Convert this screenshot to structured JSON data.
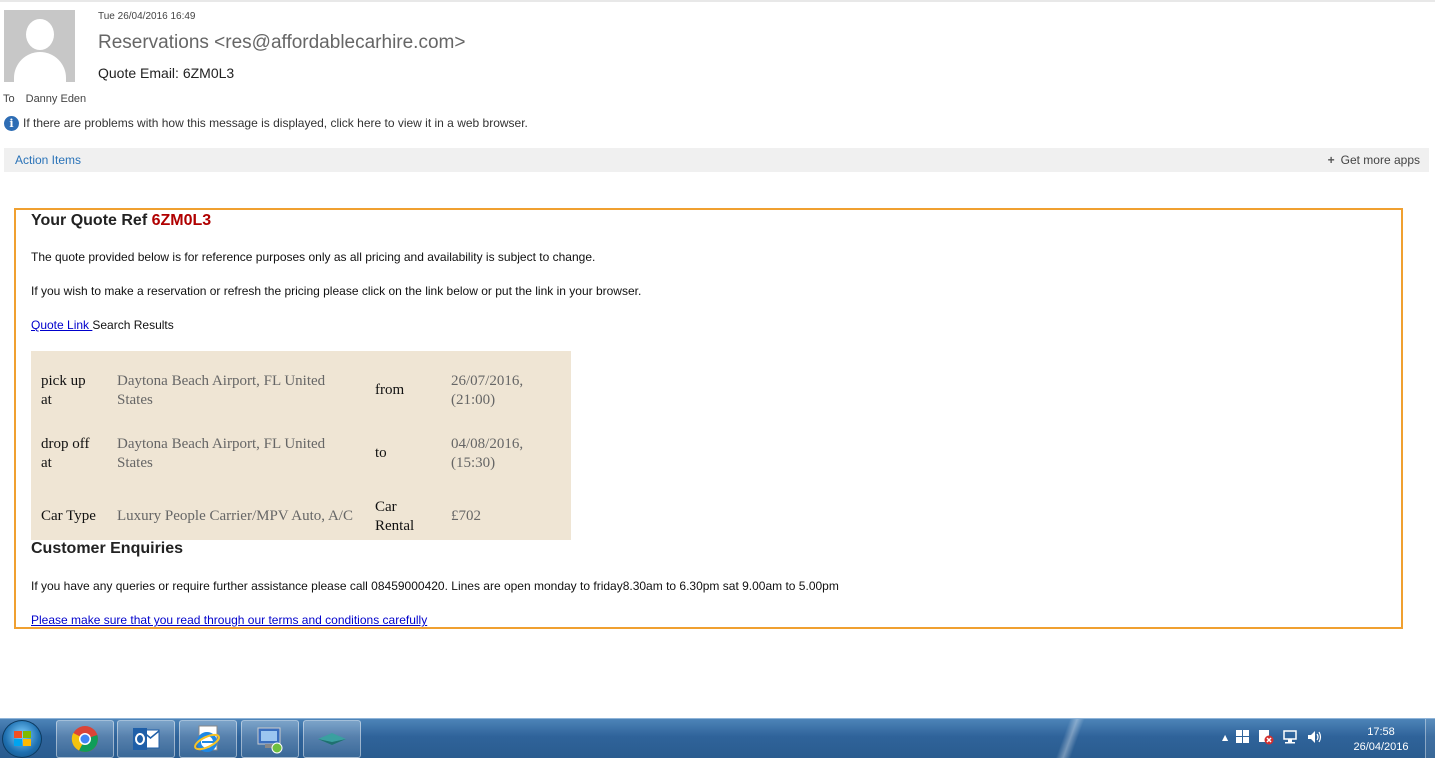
{
  "email": {
    "date": "Tue 26/04/2016 16:49",
    "sender": "Reservations <res@affordablecarhire.com>",
    "subject": "Quote Email: 6ZM0L3",
    "to_label": "To",
    "to_name": "Danny Eden",
    "info_text": "If there are problems with how this message is displayed, click here to view it in a web browser.",
    "info_icon_glyph": "i"
  },
  "action_bar": {
    "action_items": "Action Items",
    "get_more_apps_plus": "+",
    "get_more_apps": "Get more apps"
  },
  "quote": {
    "title_prefix": "Your Quote Ref",
    "ref": "6ZM0L3",
    "para1": "The quote provided below is for reference purposes only as all pricing and availability is subject to change.",
    "para2": "If you wish to make a reservation or refresh the pricing please click on the link below or put the link in your browser.",
    "quote_link": "Quote Link ",
    "search_results": "Search Results",
    "details": [
      {
        "label": "pick up at",
        "value": "Daytona Beach Airport, FL United States",
        "label2": "from",
        "value2": "26/07/2016, (21:00)"
      },
      {
        "label": "drop off at",
        "value": "Daytona Beach Airport, FL United States",
        "label2": "to",
        "value2": "04/08/2016, (15:30)"
      },
      {
        "label": "Car Type",
        "value": "Luxury People Carrier/MPV Auto, A/C",
        "label2": "Car Rental",
        "value2": "£702"
      }
    ],
    "customer_title": "Customer Enquiries",
    "para4": "If you have any queries or require further assistance please call 08459000420. Lines are open monday to friday8.30am to 6.30pm sat 9.00am to 5.00pm",
    "terms_link": "Please make sure that you read through our terms and conditions carefully"
  },
  "taskbar": {
    "apps": [
      "start-button",
      "chrome-icon",
      "outlook-icon",
      "internet-explorer-icon",
      "network-manager-icon",
      "desktop-app-icon"
    ],
    "tray_up_arrow": "▲",
    "time": "17:58",
    "date": "26/04/2016"
  }
}
